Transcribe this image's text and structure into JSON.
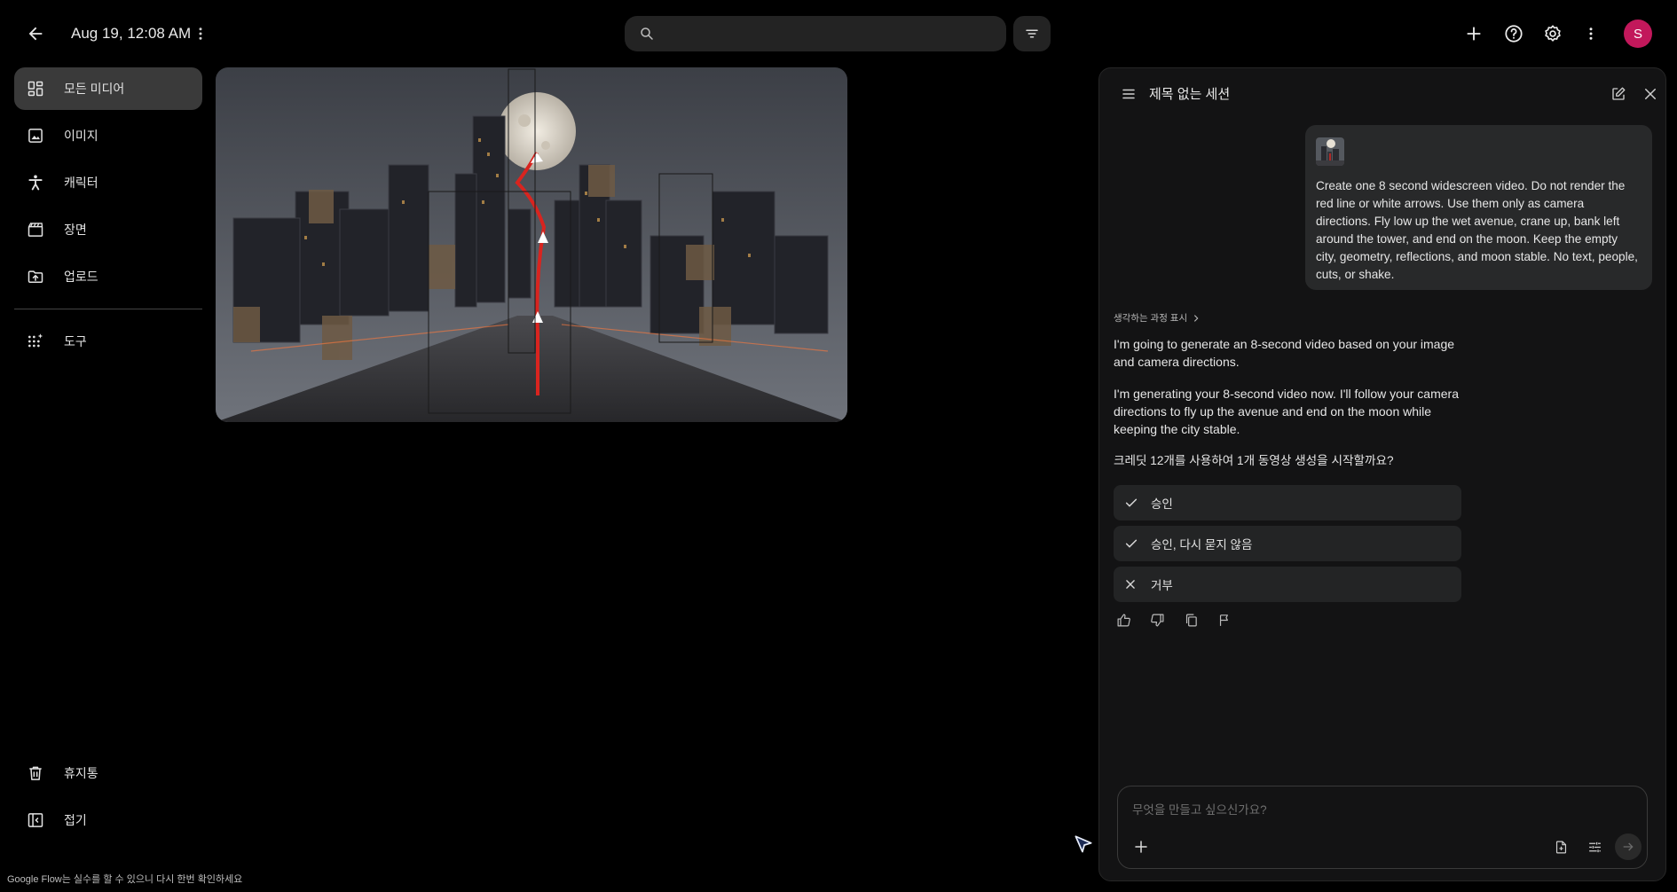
{
  "header": {
    "date": "Aug 19, 12:08 AM",
    "search_placeholder": ""
  },
  "sidebar": {
    "items": [
      {
        "label": "모든 미디어",
        "icon": "grid-icon",
        "active": true
      },
      {
        "label": "이미지",
        "icon": "image-icon"
      },
      {
        "label": "캐릭터",
        "icon": "character-icon"
      },
      {
        "label": "장면",
        "icon": "scene-icon"
      },
      {
        "label": "업로드",
        "icon": "upload-icon"
      },
      {
        "label": "도구",
        "icon": "tools-icon"
      }
    ],
    "bottom": [
      {
        "label": "휴지통",
        "icon": "trash-icon"
      },
      {
        "label": "접기",
        "icon": "collapse-icon"
      }
    ],
    "disclaimer": "Google Flow는 실수를 할 수 있으니 다시 한번 확인하세요"
  },
  "user": {
    "initial": "S",
    "avatar_color": "#c2185b"
  },
  "chat": {
    "title": "제목 없는 세션",
    "user_message": "Create one 8 second widescreen video. Do not render the red line or white arrows. Use them only as camera directions. Fly low up the wet avenue, crane up, bank left around the tower, and end on the moon. Keep the empty city, geometry, reflections, and moon stable. No text, people, cuts, or shake.",
    "thinking_toggle": "생각하는 과정 표시",
    "bot_paragraphs": [
      "I'm going to generate an 8-second video based on your image and camera directions.",
      "I'm generating your 8-second video now. I'll follow your camera directions to fly up the avenue and end on the moon while keeping the city stable."
    ],
    "question": "크레딧 12개를 사용하여 1개 동영상 생성을 시작할까요?",
    "options": [
      {
        "label": "승인",
        "icon": "check-icon"
      },
      {
        "label": "승인, 다시 묻지 않음",
        "icon": "check-icon"
      },
      {
        "label": "거부",
        "icon": "close-icon"
      }
    ],
    "composer_placeholder": "무엇을 만들고 싶으신가요?"
  }
}
